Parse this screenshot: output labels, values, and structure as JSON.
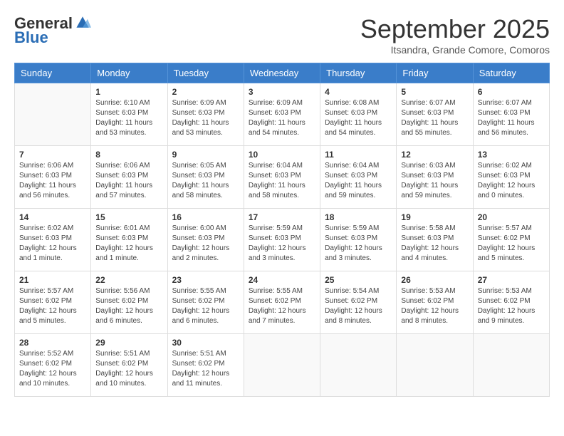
{
  "logo": {
    "general": "General",
    "blue": "Blue"
  },
  "header": {
    "month": "September 2025",
    "location": "Itsandra, Grande Comore, Comoros"
  },
  "weekdays": [
    "Sunday",
    "Monday",
    "Tuesday",
    "Wednesday",
    "Thursday",
    "Friday",
    "Saturday"
  ],
  "weeks": [
    [
      {
        "day": null,
        "info": null
      },
      {
        "day": "1",
        "info": "Sunrise: 6:10 AM\nSunset: 6:03 PM\nDaylight: 11 hours\nand 53 minutes."
      },
      {
        "day": "2",
        "info": "Sunrise: 6:09 AM\nSunset: 6:03 PM\nDaylight: 11 hours\nand 53 minutes."
      },
      {
        "day": "3",
        "info": "Sunrise: 6:09 AM\nSunset: 6:03 PM\nDaylight: 11 hours\nand 54 minutes."
      },
      {
        "day": "4",
        "info": "Sunrise: 6:08 AM\nSunset: 6:03 PM\nDaylight: 11 hours\nand 54 minutes."
      },
      {
        "day": "5",
        "info": "Sunrise: 6:07 AM\nSunset: 6:03 PM\nDaylight: 11 hours\nand 55 minutes."
      },
      {
        "day": "6",
        "info": "Sunrise: 6:07 AM\nSunset: 6:03 PM\nDaylight: 11 hours\nand 56 minutes."
      }
    ],
    [
      {
        "day": "7",
        "info": "Sunrise: 6:06 AM\nSunset: 6:03 PM\nDaylight: 11 hours\nand 56 minutes."
      },
      {
        "day": "8",
        "info": "Sunrise: 6:06 AM\nSunset: 6:03 PM\nDaylight: 11 hours\nand 57 minutes."
      },
      {
        "day": "9",
        "info": "Sunrise: 6:05 AM\nSunset: 6:03 PM\nDaylight: 11 hours\nand 58 minutes."
      },
      {
        "day": "10",
        "info": "Sunrise: 6:04 AM\nSunset: 6:03 PM\nDaylight: 11 hours\nand 58 minutes."
      },
      {
        "day": "11",
        "info": "Sunrise: 6:04 AM\nSunset: 6:03 PM\nDaylight: 11 hours\nand 59 minutes."
      },
      {
        "day": "12",
        "info": "Sunrise: 6:03 AM\nSunset: 6:03 PM\nDaylight: 11 hours\nand 59 minutes."
      },
      {
        "day": "13",
        "info": "Sunrise: 6:02 AM\nSunset: 6:03 PM\nDaylight: 12 hours\nand 0 minutes."
      }
    ],
    [
      {
        "day": "14",
        "info": "Sunrise: 6:02 AM\nSunset: 6:03 PM\nDaylight: 12 hours\nand 1 minute."
      },
      {
        "day": "15",
        "info": "Sunrise: 6:01 AM\nSunset: 6:03 PM\nDaylight: 12 hours\nand 1 minute."
      },
      {
        "day": "16",
        "info": "Sunrise: 6:00 AM\nSunset: 6:03 PM\nDaylight: 12 hours\nand 2 minutes."
      },
      {
        "day": "17",
        "info": "Sunrise: 5:59 AM\nSunset: 6:03 PM\nDaylight: 12 hours\nand 3 minutes."
      },
      {
        "day": "18",
        "info": "Sunrise: 5:59 AM\nSunset: 6:03 PM\nDaylight: 12 hours\nand 3 minutes."
      },
      {
        "day": "19",
        "info": "Sunrise: 5:58 AM\nSunset: 6:03 PM\nDaylight: 12 hours\nand 4 minutes."
      },
      {
        "day": "20",
        "info": "Sunrise: 5:57 AM\nSunset: 6:02 PM\nDaylight: 12 hours\nand 5 minutes."
      }
    ],
    [
      {
        "day": "21",
        "info": "Sunrise: 5:57 AM\nSunset: 6:02 PM\nDaylight: 12 hours\nand 5 minutes."
      },
      {
        "day": "22",
        "info": "Sunrise: 5:56 AM\nSunset: 6:02 PM\nDaylight: 12 hours\nand 6 minutes."
      },
      {
        "day": "23",
        "info": "Sunrise: 5:55 AM\nSunset: 6:02 PM\nDaylight: 12 hours\nand 6 minutes."
      },
      {
        "day": "24",
        "info": "Sunrise: 5:55 AM\nSunset: 6:02 PM\nDaylight: 12 hours\nand 7 minutes."
      },
      {
        "day": "25",
        "info": "Sunrise: 5:54 AM\nSunset: 6:02 PM\nDaylight: 12 hours\nand 8 minutes."
      },
      {
        "day": "26",
        "info": "Sunrise: 5:53 AM\nSunset: 6:02 PM\nDaylight: 12 hours\nand 8 minutes."
      },
      {
        "day": "27",
        "info": "Sunrise: 5:53 AM\nSunset: 6:02 PM\nDaylight: 12 hours\nand 9 minutes."
      }
    ],
    [
      {
        "day": "28",
        "info": "Sunrise: 5:52 AM\nSunset: 6:02 PM\nDaylight: 12 hours\nand 10 minutes."
      },
      {
        "day": "29",
        "info": "Sunrise: 5:51 AM\nSunset: 6:02 PM\nDaylight: 12 hours\nand 10 minutes."
      },
      {
        "day": "30",
        "info": "Sunrise: 5:51 AM\nSunset: 6:02 PM\nDaylight: 12 hours\nand 11 minutes."
      },
      {
        "day": null,
        "info": null
      },
      {
        "day": null,
        "info": null
      },
      {
        "day": null,
        "info": null
      },
      {
        "day": null,
        "info": null
      }
    ]
  ]
}
